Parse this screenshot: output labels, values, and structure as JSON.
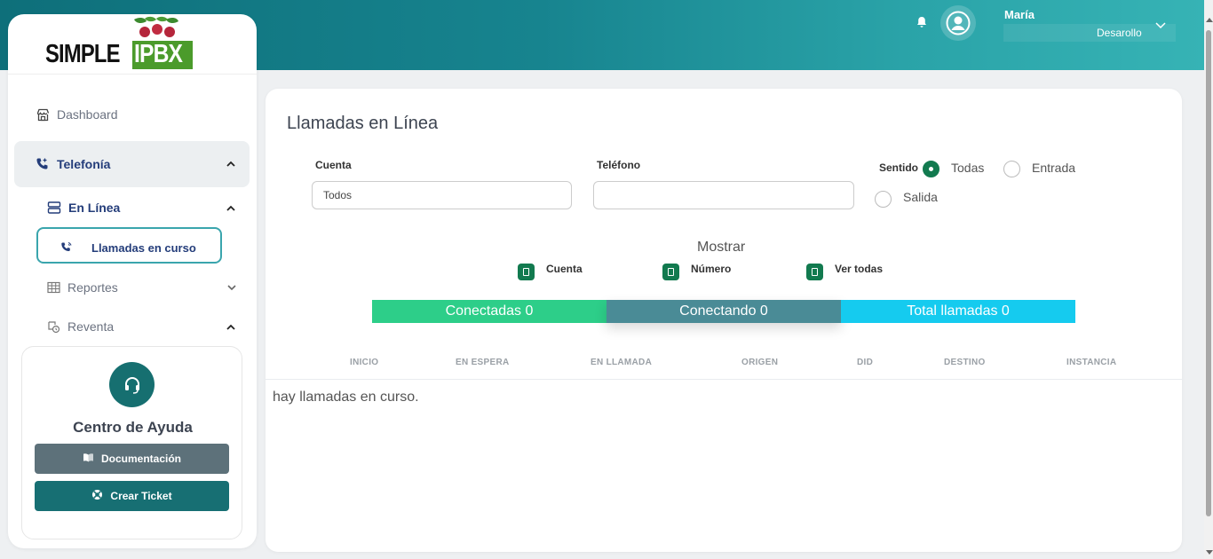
{
  "header": {
    "user_name": "María",
    "user_role": "Desarollo"
  },
  "brand": {
    "left": "SIMPLE",
    "right": "IPBX"
  },
  "sidebar": {
    "dashboard": "Dashboard",
    "telefonia": "Telefonía",
    "en_linea": "En Línea",
    "llamadas_en_curso": "Llamadas en curso",
    "reportes": "Reportes",
    "reventa": "Reventa"
  },
  "help": {
    "title": "Centro de Ayuda",
    "doc_button": "Documentación",
    "ticket_button": "Crear Ticket"
  },
  "main": {
    "title": "Llamadas en Línea",
    "cuenta_label": "Cuenta",
    "cuenta_value": "Todos",
    "telefono_label": "Teléfono",
    "telefono_value": "",
    "sentido_label": "Sentido",
    "sentido_options": [
      "Todas",
      "Entrada",
      "Salida"
    ],
    "sentido_selected": "Todas",
    "mostrar_label": "Mostrar",
    "mostrar_options": [
      "Cuenta",
      "Número",
      "Ver todas"
    ],
    "stats": {
      "conectadas": "Conectadas 0",
      "conectando": "Conectando 0",
      "total": "Total llamadas 0"
    },
    "columns": [
      "INICIO",
      "EN ESPERA",
      "EN LLAMADA",
      "ORIGEN",
      "DID",
      "DESTINO",
      "INSTANCIA"
    ],
    "empty_message": "hay llamadas en curso."
  },
  "colors": {
    "accent": "#176f73",
    "conectadas": "#2dce89",
    "conectando": "#4a8b96",
    "total": "#15cbef",
    "check": "#127a4f"
  }
}
